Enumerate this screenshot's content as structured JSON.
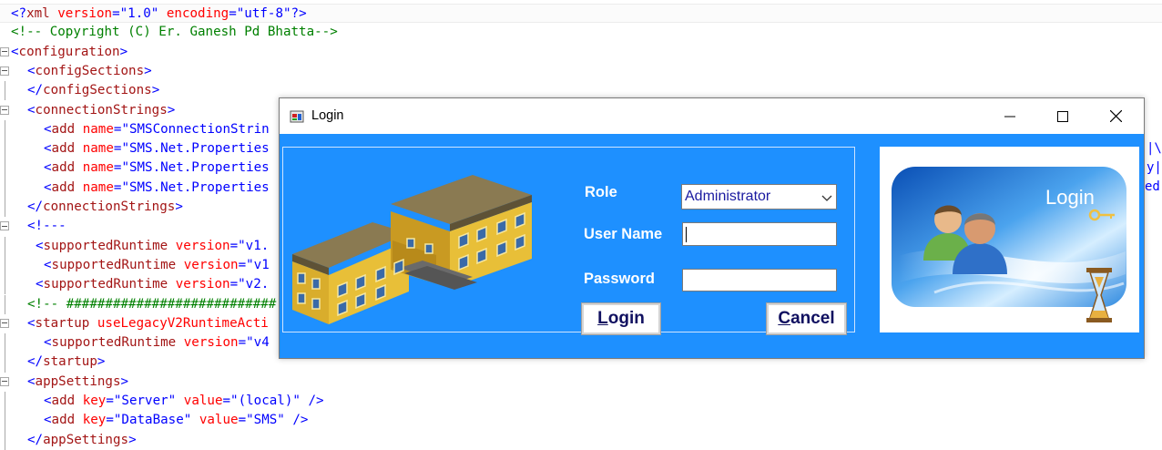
{
  "editor": {
    "lines": [
      {
        "indent": 0,
        "tokens": [
          {
            "t": "<?",
            "c": "br"
          },
          {
            "t": "xml",
            "c": "tag"
          },
          {
            "t": " version",
            "c": "attr"
          },
          {
            "t": "=",
            "c": "br"
          },
          {
            "t": "\"1.0\"",
            "c": "val"
          },
          {
            "t": " encoding",
            "c": "attr"
          },
          {
            "t": "=",
            "c": "br"
          },
          {
            "t": "\"utf-8\"",
            "c": "val"
          },
          {
            "t": "?>",
            "c": "br"
          }
        ]
      },
      {
        "indent": 0,
        "tokens": [
          {
            "t": "<!-- Copyright (C) Er. Ganesh Pd Bhatta-->",
            "c": "com"
          }
        ]
      },
      {
        "indent": 0,
        "fold": true,
        "tokens": [
          {
            "t": "<",
            "c": "br"
          },
          {
            "t": "configuration",
            "c": "tag"
          },
          {
            "t": ">",
            "c": "br"
          }
        ]
      },
      {
        "indent": 1,
        "fold": true,
        "tokens": [
          {
            "t": "<",
            "c": "br"
          },
          {
            "t": "configSections",
            "c": "tag"
          },
          {
            "t": ">",
            "c": "br"
          }
        ]
      },
      {
        "indent": 1,
        "tokens": [
          {
            "t": "</",
            "c": "br"
          },
          {
            "t": "configSections",
            "c": "tag"
          },
          {
            "t": ">",
            "c": "br"
          }
        ]
      },
      {
        "indent": 1,
        "fold": true,
        "tokens": [
          {
            "t": "<",
            "c": "br"
          },
          {
            "t": "connectionStrings",
            "c": "tag"
          },
          {
            "t": ">",
            "c": "br"
          }
        ]
      },
      {
        "indent": 2,
        "tokens": [
          {
            "t": "<",
            "c": "br"
          },
          {
            "t": "add",
            "c": "tag"
          },
          {
            "t": " name",
            "c": "attr"
          },
          {
            "t": "=",
            "c": "br"
          },
          {
            "t": "\"SMSConnectionStrin",
            "c": "val"
          }
        ]
      },
      {
        "indent": 2,
        "tokens": [
          {
            "t": "<",
            "c": "br"
          },
          {
            "t": "add",
            "c": "tag"
          },
          {
            "t": " name",
            "c": "attr"
          },
          {
            "t": "=",
            "c": "br"
          },
          {
            "t": "\"SMS.Net.Properties",
            "c": "val"
          }
        ]
      },
      {
        "indent": 2,
        "tokens": [
          {
            "t": "<",
            "c": "br"
          },
          {
            "t": "add",
            "c": "tag"
          },
          {
            "t": " name",
            "c": "attr"
          },
          {
            "t": "=",
            "c": "br"
          },
          {
            "t": "\"SMS.Net.Properties",
            "c": "val"
          }
        ]
      },
      {
        "indent": 2,
        "tokens": [
          {
            "t": "<",
            "c": "br"
          },
          {
            "t": "add",
            "c": "tag"
          },
          {
            "t": " name",
            "c": "attr"
          },
          {
            "t": "=",
            "c": "br"
          },
          {
            "t": "\"SMS.Net.Properties",
            "c": "val"
          }
        ]
      },
      {
        "indent": 1,
        "tokens": [
          {
            "t": "</",
            "c": "br"
          },
          {
            "t": "connectionStrings",
            "c": "tag"
          },
          {
            "t": ">",
            "c": "br"
          }
        ]
      },
      {
        "indent": 1,
        "fold": true,
        "tokens": [
          {
            "t": "<!---",
            "c": "br"
          }
        ]
      },
      {
        "indent": 1.5,
        "tokens": [
          {
            "t": "<",
            "c": "br"
          },
          {
            "t": "supportedRuntime",
            "c": "tag"
          },
          {
            "t": " version",
            "c": "attr"
          },
          {
            "t": "=",
            "c": "br"
          },
          {
            "t": "\"v1.",
            "c": "val"
          }
        ]
      },
      {
        "indent": 2,
        "tokens": [
          {
            "t": "<",
            "c": "br"
          },
          {
            "t": "supportedRuntime",
            "c": "tag"
          },
          {
            "t": " version",
            "c": "attr"
          },
          {
            "t": "=",
            "c": "br"
          },
          {
            "t": "\"v1",
            "c": "val"
          }
        ]
      },
      {
        "indent": 1.5,
        "tokens": [
          {
            "t": "<",
            "c": "br"
          },
          {
            "t": "supportedRuntime",
            "c": "tag"
          },
          {
            "t": " version",
            "c": "attr"
          },
          {
            "t": "=",
            "c": "br"
          },
          {
            "t": "\"v2.",
            "c": "val"
          }
        ]
      },
      {
        "indent": 1,
        "tokens": [
          {
            "t": "<!-- ###########################",
            "c": "com"
          }
        ]
      },
      {
        "indent": 1,
        "fold": true,
        "tokens": [
          {
            "t": "<",
            "c": "br"
          },
          {
            "t": "startup",
            "c": "tag"
          },
          {
            "t": " useLegacyV2RuntimeActi",
            "c": "attr"
          }
        ]
      },
      {
        "indent": 2,
        "tokens": [
          {
            "t": "<",
            "c": "br"
          },
          {
            "t": "supportedRuntime",
            "c": "tag"
          },
          {
            "t": " version",
            "c": "attr"
          },
          {
            "t": "=",
            "c": "br"
          },
          {
            "t": "\"v4",
            "c": "val"
          }
        ]
      },
      {
        "indent": 1,
        "tokens": [
          {
            "t": "</",
            "c": "br"
          },
          {
            "t": "startup",
            "c": "tag"
          },
          {
            "t": ">",
            "c": "br"
          }
        ]
      },
      {
        "indent": 1,
        "fold": true,
        "tokens": [
          {
            "t": "<",
            "c": "br"
          },
          {
            "t": "appSettings",
            "c": "tag"
          },
          {
            "t": ">",
            "c": "br"
          }
        ]
      },
      {
        "indent": 2,
        "tokens": [
          {
            "t": "<",
            "c": "br"
          },
          {
            "t": "add",
            "c": "tag"
          },
          {
            "t": " key",
            "c": "attr"
          },
          {
            "t": "=",
            "c": "br"
          },
          {
            "t": "\"Server\"",
            "c": "val"
          },
          {
            "t": " value",
            "c": "attr"
          },
          {
            "t": "=",
            "c": "br"
          },
          {
            "t": "\"(local)\"",
            "c": "val"
          },
          {
            "t": " />",
            "c": "br"
          }
        ]
      },
      {
        "indent": 2,
        "tokens": [
          {
            "t": "<",
            "c": "br"
          },
          {
            "t": "add",
            "c": "tag"
          },
          {
            "t": " key",
            "c": "attr"
          },
          {
            "t": "=",
            "c": "br"
          },
          {
            "t": "\"DataBase\"",
            "c": "val"
          },
          {
            "t": " value",
            "c": "attr"
          },
          {
            "t": "=",
            "c": "br"
          },
          {
            "t": "\"SMS\"",
            "c": "val"
          },
          {
            "t": " />",
            "c": "br"
          }
        ]
      },
      {
        "indent": 1,
        "tokens": [
          {
            "t": "</",
            "c": "br"
          },
          {
            "t": "appSettings",
            "c": "tag"
          },
          {
            "t": ">",
            "c": "br"
          }
        ]
      }
    ],
    "right_fragments": [
      "|\\F",
      "y|'",
      "ed"
    ]
  },
  "login_window": {
    "title": "Login",
    "role_label": "Role",
    "role_value": "Administrator",
    "username_label": "User Name",
    "username_value": "",
    "password_label": "Password",
    "password_value": "",
    "login_button": {
      "pre": "",
      "accel": "L",
      "post": "ogin"
    },
    "cancel_button": {
      "pre": "",
      "accel": "C",
      "post": "ancel"
    },
    "banner_text": "Login"
  },
  "colors": {
    "dialog_bg": "#1e90ff",
    "xml_tag": "#a31515",
    "xml_attr": "#ff0000",
    "xml_value": "#0000ff",
    "xml_comment": "#008000"
  },
  "icons": [
    "app-icon",
    "minimize-icon",
    "maximize-icon",
    "close-icon",
    "chevron-down-icon",
    "building-icon",
    "users-icon",
    "key-icon",
    "hourglass-icon",
    "fold-toggle-icon"
  ]
}
